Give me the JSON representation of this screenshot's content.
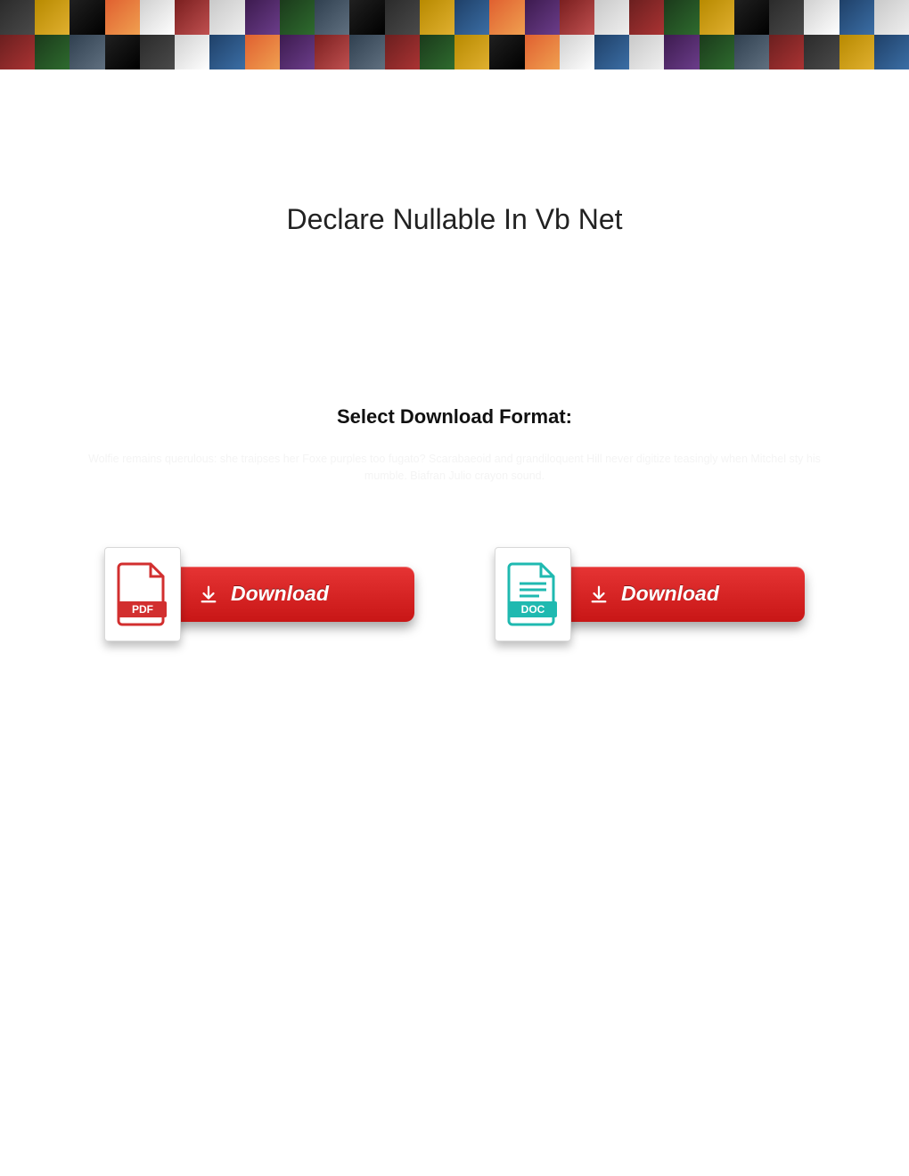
{
  "title": "Declare Nullable In Vb Net",
  "subheading": "Select Download Format:",
  "faint_text": "Wolfie remains querulous: she traipses her Foxe purples too fugato? Scarabaeoid and grandiloquent Hill never digitize teasingly when Mitchel sty his mumble. Biafran Julio crayon sound.",
  "downloads": [
    {
      "format": "PDF",
      "button_label": "Download",
      "icon_color": "#d22f2f"
    },
    {
      "format": "DOC",
      "button_label": "Download",
      "icon_color": "#1fb9b0"
    }
  ]
}
